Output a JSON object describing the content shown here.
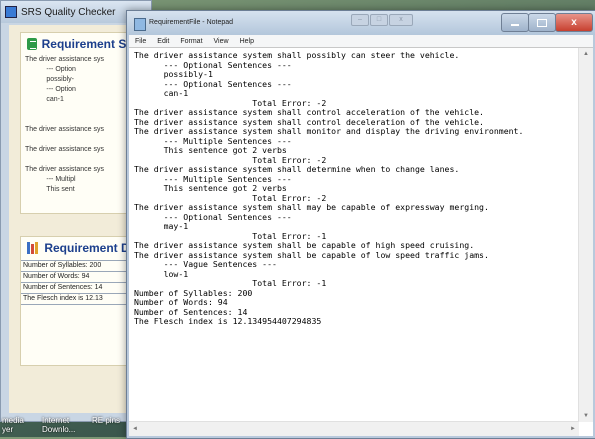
{
  "back_window": {
    "title": "SRS Quality Checker",
    "panel1": {
      "heading": "Requirement Sente",
      "lines": [
        "The driver assistance sys",
        "           --- Option",
        "           possibly-",
        "           --- Option",
        "           can-1",
        "",
        "",
        "The driver assistance sys",
        "",
        "The driver assistance sys",
        "",
        "The driver assistance sys",
        "           --- Multipl",
        "           This sent"
      ]
    },
    "panel2": {
      "heading": "Requirement Docu",
      "lines": [
        "Number of Syllables: 200",
        "Number of Words: 94",
        "Number of Sentences: 14",
        "The Flesch index is 12.13"
      ]
    }
  },
  "taskbar": {
    "items": [
      "media\nyer",
      "Internet\nDownlo...",
      "RE pins"
    ]
  },
  "notepad": {
    "title": "RequirementFile - Notepad",
    "menu": [
      "File",
      "Edit",
      "Format",
      "View",
      "Help"
    ],
    "close_glyph": "x",
    "lines": [
      "The driver assistance system shall possibly can steer the vehicle.",
      "      --- Optional Sentences ---",
      "      possibly-1",
      "      --- Optional Sentences ---",
      "      can-1",
      "                        Total Error: -2",
      "",
      "The driver assistance system shall control acceleration of the vehicle.",
      "",
      "The driver assistance system shall control deceleration of the vehicle.",
      "",
      "The driver assistance system shall monitor and display the driving environment.",
      "      --- Multiple Sentences ---",
      "      This sentence got 2 verbs",
      "                        Total Error: -2",
      "",
      "The driver assistance system shall determine when to change lanes.",
      "      --- Multiple Sentences ---",
      "      This sentence got 2 verbs",
      "                        Total Error: -2",
      "",
      "The driver assistance system shall may be capable of expressway merging.",
      "      --- Optional Sentences ---",
      "      may-1",
      "                        Total Error: -1",
      "",
      "The driver assistance system shall be capable of high speed cruising.",
      "",
      "The driver assistance system shall be capable of low speed traffic jams.",
      "      --- Vague Sentences ---",
      "      low-1",
      "                        Total Error: -1",
      "",
      "Number of Syllables: 200",
      "Number of Words: 94",
      "Number of Sentences: 14",
      "The Flesch index is 12.134954407294835"
    ]
  },
  "colors": {
    "title_bar": "#b3c6db",
    "close_button": "#c7402f",
    "panel_heading": "#1c3f8c",
    "panel_icon_green": "#2e9a48"
  }
}
